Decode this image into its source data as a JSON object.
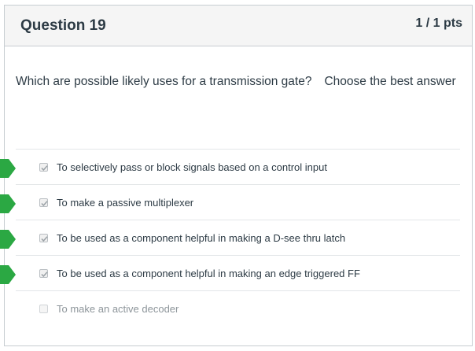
{
  "question": {
    "title": "Question 19",
    "points": "1 / 1 pts",
    "text": "Which are possible likely uses for a transmission gate?",
    "instruction": "Choose the best answer"
  },
  "answers": [
    {
      "label": "To selectively pass or block signals based on a control input",
      "checked": true,
      "correct_marker": true
    },
    {
      "label": "To make a passive multiplexer",
      "checked": true,
      "correct_marker": true
    },
    {
      "label": "To be used as a component helpful in making a D-see thru latch",
      "checked": true,
      "correct_marker": true
    },
    {
      "label": "To be used as a component helpful in making an edge triggered FF",
      "checked": true,
      "correct_marker": true
    },
    {
      "label": "To make an active decoder",
      "checked": false,
      "correct_marker": false
    }
  ],
  "colors": {
    "correct_marker": "#2ba843",
    "header_bg": "#f5f5f5",
    "border": "#c7cdd1"
  }
}
